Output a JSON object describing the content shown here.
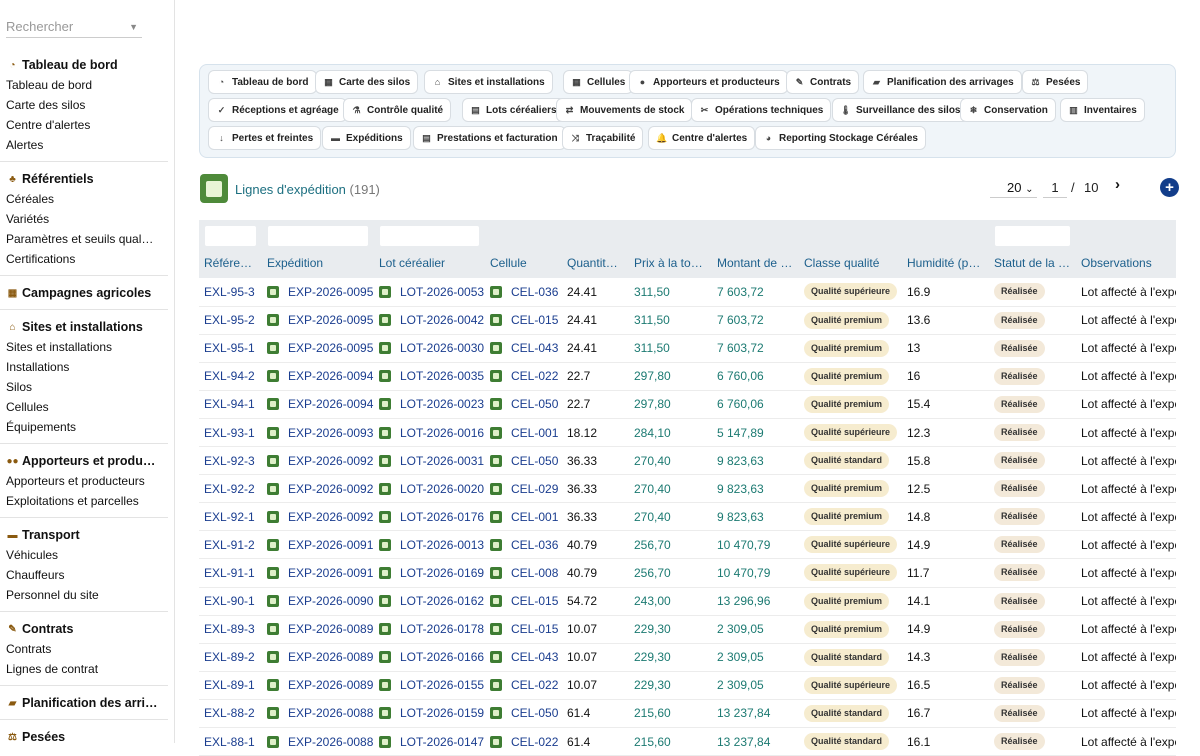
{
  "sidebar": {
    "search_placeholder": "Rechercher",
    "sections": [
      {
        "title": "Tableau de bord",
        "icon": "gauge-icon",
        "items": [
          "Tableau de bord",
          "Carte des silos",
          "Centre d'alertes",
          "Alertes"
        ]
      },
      {
        "title": "Référentiels",
        "icon": "sprout-icon",
        "items": [
          "Céréales",
          "Variétés",
          "Paramètres et seuils qual…",
          "Certifications"
        ]
      },
      {
        "title": "Campagnes agricoles",
        "icon": "calendar-icon",
        "items": []
      },
      {
        "title": "Sites et installations",
        "icon": "warehouse-icon",
        "items": [
          "Sites et installations",
          "Installations",
          "Silos",
          "Cellules",
          "Équipements"
        ]
      },
      {
        "title": "Apporteurs et produ…",
        "icon": "users-icon",
        "items": [
          "Apporteurs et producteurs",
          "Exploitations et parcelles"
        ]
      },
      {
        "title": "Transport",
        "icon": "truck-icon",
        "items": [
          "Véhicules",
          "Chauffeurs",
          "Personnel du site"
        ]
      },
      {
        "title": "Contrats",
        "icon": "contract-icon",
        "items": [
          "Contrats",
          "Lignes de contrat"
        ]
      },
      {
        "title": "Planification des arri…",
        "icon": "truck-ramp-icon",
        "items": []
      },
      {
        "title": "Pesées",
        "icon": "scale-icon",
        "items": []
      }
    ]
  },
  "nav_chips": [
    [
      "Tableau de bord",
      "Carte des silos",
      "Sites et installations",
      "Cellules",
      "Apporteurs et producteurs",
      "Contrats",
      "Planification des arrivages",
      "Pesées"
    ],
    [
      "Réceptions et agréage",
      "Contrôle qualité",
      "Lots céréaliers",
      "Mouvements de stock",
      "Opérations techniques",
      "Surveillance des silos",
      "Conservation",
      "Inventaires"
    ],
    [
      "Pertes et freintes",
      "Expéditions",
      "Prestations et facturation",
      "Traçabilité",
      "Centre d'alertes",
      "Reporting Stockage Céréales"
    ]
  ],
  "list": {
    "title": "Lignes d'expédition",
    "count": "(191)",
    "per_page": "20",
    "page": "1",
    "page_sep": "/",
    "total_pages": "10",
    "next_label": "›",
    "add_label": "+"
  },
  "table": {
    "columns": [
      "Référence",
      "Expédition",
      "Lot céréalier",
      "Cellule",
      "Quantité (t)",
      "Prix à la tonne",
      "Montant de l…",
      "Classe qualité",
      "Humidité (po…",
      "Statut de la li…",
      "Observations"
    ],
    "rows": [
      [
        "EXL-95-3",
        "EXP-2026-0095",
        "LOT-2026-0053",
        "CEL-036",
        "24.41",
        "311,50",
        "7 603,72",
        "Qualité supérieure",
        "16.9",
        "Réalisée",
        "Lot affecté à l'expé"
      ],
      [
        "EXL-95-2",
        "EXP-2026-0095",
        "LOT-2026-0042",
        "CEL-015",
        "24.41",
        "311,50",
        "7 603,72",
        "Qualité premium",
        "13.6",
        "Réalisée",
        "Lot affecté à l'expé"
      ],
      [
        "EXL-95-1",
        "EXP-2026-0095",
        "LOT-2026-0030",
        "CEL-043",
        "24.41",
        "311,50",
        "7 603,72",
        "Qualité premium",
        "13",
        "Réalisée",
        "Lot affecté à l'expé"
      ],
      [
        "EXL-94-2",
        "EXP-2026-0094",
        "LOT-2026-0035",
        "CEL-022",
        "22.7",
        "297,80",
        "6 760,06",
        "Qualité premium",
        "16",
        "Réalisée",
        "Lot affecté à l'expé"
      ],
      [
        "EXL-94-1",
        "EXP-2026-0094",
        "LOT-2026-0023",
        "CEL-050",
        "22.7",
        "297,80",
        "6 760,06",
        "Qualité premium",
        "15.4",
        "Réalisée",
        "Lot affecté à l'expé"
      ],
      [
        "EXL-93-1",
        "EXP-2026-0093",
        "LOT-2026-0016",
        "CEL-001",
        "18.12",
        "284,10",
        "5 147,89",
        "Qualité supérieure",
        "12.3",
        "Réalisée",
        "Lot affecté à l'expé"
      ],
      [
        "EXL-92-3",
        "EXP-2026-0092",
        "LOT-2026-0031",
        "CEL-050",
        "36.33",
        "270,40",
        "9 823,63",
        "Qualité standard",
        "15.8",
        "Réalisée",
        "Lot affecté à l'expé"
      ],
      [
        "EXL-92-2",
        "EXP-2026-0092",
        "LOT-2026-0020",
        "CEL-029",
        "36.33",
        "270,40",
        "9 823,63",
        "Qualité premium",
        "12.5",
        "Réalisée",
        "Lot affecté à l'expé"
      ],
      [
        "EXL-92-1",
        "EXP-2026-0092",
        "LOT-2026-0176",
        "CEL-001",
        "36.33",
        "270,40",
        "9 823,63",
        "Qualité premium",
        "14.8",
        "Réalisée",
        "Lot affecté à l'expé"
      ],
      [
        "EXL-91-2",
        "EXP-2026-0091",
        "LOT-2026-0013",
        "CEL-036",
        "40.79",
        "256,70",
        "10 470,79",
        "Qualité supérieure",
        "14.9",
        "Réalisée",
        "Lot affecté à l'expé"
      ],
      [
        "EXL-91-1",
        "EXP-2026-0091",
        "LOT-2026-0169",
        "CEL-008",
        "40.79",
        "256,70",
        "10 470,79",
        "Qualité supérieure",
        "11.7",
        "Réalisée",
        "Lot affecté à l'expé"
      ],
      [
        "EXL-90-1",
        "EXP-2026-0090",
        "LOT-2026-0162",
        "CEL-015",
        "54.72",
        "243,00",
        "13 296,96",
        "Qualité premium",
        "14.1",
        "Réalisée",
        "Lot affecté à l'expé"
      ],
      [
        "EXL-89-3",
        "EXP-2026-0089",
        "LOT-2026-0178",
        "CEL-015",
        "10.07",
        "229,30",
        "2 309,05",
        "Qualité premium",
        "14.9",
        "Réalisée",
        "Lot affecté à l'expé"
      ],
      [
        "EXL-89-2",
        "EXP-2026-0089",
        "LOT-2026-0166",
        "CEL-043",
        "10.07",
        "229,30",
        "2 309,05",
        "Qualité standard",
        "14.3",
        "Réalisée",
        "Lot affecté à l'expé"
      ],
      [
        "EXL-89-1",
        "EXP-2026-0089",
        "LOT-2026-0155",
        "CEL-022",
        "10.07",
        "229,30",
        "2 309,05",
        "Qualité supérieure",
        "16.5",
        "Réalisée",
        "Lot affecté à l'expé"
      ],
      [
        "EXL-88-2",
        "EXP-2026-0088",
        "LOT-2026-0159",
        "CEL-050",
        "61.4",
        "215,60",
        "13 237,84",
        "Qualité standard",
        "16.7",
        "Réalisée",
        "Lot affecté à l'expé"
      ],
      [
        "EXL-88-1",
        "EXP-2026-0088",
        "LOT-2026-0147",
        "CEL-022",
        "61.4",
        "215,60",
        "13 237,84",
        "Qualité standard",
        "16.1",
        "Réalisée",
        "Lot affecté à l'expé"
      ]
    ]
  }
}
